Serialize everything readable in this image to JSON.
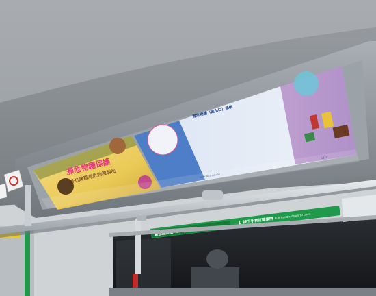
{
  "scene": {
    "kind": "photo",
    "colors": {
      "ceiling": "#7f8388",
      "panel_frame": "#8e959b",
      "poster_left_bg": "#f2d36a",
      "poster_right_bg": "#dfe9f6",
      "sign_green": "#1f9a4a",
      "handrail": "#c8cdd2",
      "red_pole": "#c42a2a",
      "window_dark": "#1c1e22"
    }
  },
  "posters": {
    "left": {
      "headline": "瀕危物種保護",
      "subline": "請勿購買瀕危物種製品"
    },
    "right": {
      "heading": "瀕危物種（進出口）條例",
      "footer_site": "www.afcd.gov.hk",
      "footer_phone": "1823"
    }
  },
  "signs": {
    "upper_green": {
      "zh": "緊急通風扇",
      "en": "Emergency ventilation"
    },
    "lower_green": {
      "zh": "按下手柄打開車門",
      "en": "Pull handle down to open"
    }
  }
}
